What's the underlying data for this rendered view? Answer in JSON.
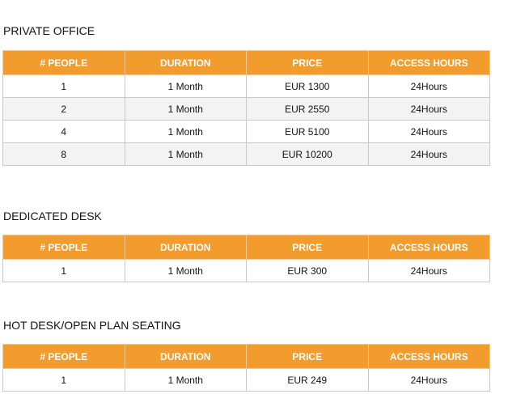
{
  "sections": [
    {
      "title": "PRIVATE OFFICE",
      "headers": [
        "# PEOPLE",
        "DURATION",
        "PRICE",
        "ACCESS HOURS"
      ],
      "rows": [
        [
          "1",
          "1 Month",
          "EUR 1300",
          "24Hours"
        ],
        [
          "2",
          "1 Month",
          "EUR 2550",
          "24Hours"
        ],
        [
          "4",
          "1 Month",
          "EUR 5100",
          "24Hours"
        ],
        [
          "8",
          "1 Month",
          "EUR 10200",
          "24Hours"
        ]
      ]
    },
    {
      "title": "DEDICATED DESK",
      "headers": [
        "# PEOPLE",
        "DURATION",
        "PRICE",
        "ACCESS HOURS"
      ],
      "rows": [
        [
          "1",
          "1 Month",
          "EUR 300",
          "24Hours"
        ]
      ]
    },
    {
      "title": "HOT DESK/OPEN PLAN SEATING",
      "headers": [
        "# PEOPLE",
        "DURATION",
        "PRICE",
        "ACCESS HOURS"
      ],
      "rows": [
        [
          "1",
          "1 Month",
          "EUR 249",
          "24Hours"
        ]
      ]
    }
  ],
  "colors": {
    "header_bg": "#f39c2e",
    "header_text": "#ffffff",
    "alt_row_bg": "#f3f3f3",
    "border": "#c9c9c9"
  }
}
